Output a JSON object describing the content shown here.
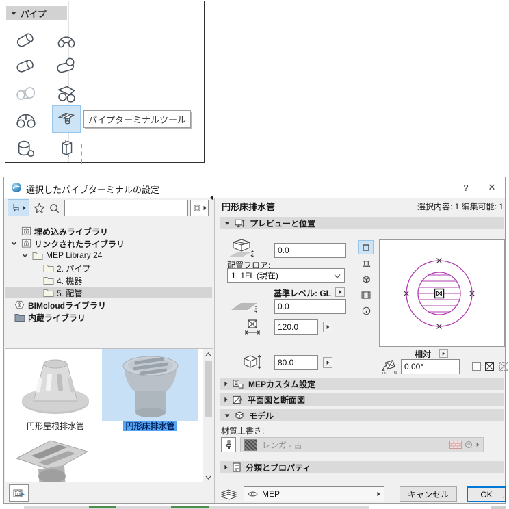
{
  "colors": {
    "selection_fill": "#cde4f7",
    "selection_border": "#96c6ec",
    "thumb_label_bg": "#54a5f6",
    "preview_magenta": "#b13cb1",
    "ok_border": "#0078d7",
    "guide_orange": "#ef8b3a"
  },
  "palette": {
    "header_label": "パイプ",
    "tooltip": "パイプターミナルツール",
    "tool_icons": [
      "pipe-straight",
      "pipe-bend",
      "pipe-straight-2",
      "pipe-tee",
      "pipe-transition",
      "pipe-wye",
      "pipe-double-bend",
      "pipe-terminal",
      "pipe-takeoff",
      "pipe-inline-object"
    ],
    "selected_tool": "pipe-terminal"
  },
  "dialog": {
    "title": "選択したパイプターミナルの設定",
    "help_label": "?",
    "close_label": "✕",
    "library_panel": {
      "search_value": "",
      "toolbar_icons": [
        "object-tool",
        "favorites-star",
        "search",
        "settings-gear"
      ],
      "tree": [
        {
          "label": "埋め込みライブラリ"
        },
        {
          "label": "リンクされたライブラリ"
        },
        {
          "label": "MEP Library 24"
        },
        {
          "label": "2. パイプ"
        },
        {
          "label": "4. 機器"
        },
        {
          "label": "5. 配管"
        },
        {
          "label": "BIMcloudライブラリ"
        },
        {
          "label": "内蔵ライブラリ"
        }
      ],
      "thumbnails": [
        {
          "label": "円形屋根排水管"
        },
        {
          "label": "円形床排水管"
        },
        {
          "label": ""
        }
      ]
    },
    "settings_panel": {
      "object_name": "円形床排水管",
      "selection_info": "選択内容: 1 編集可能: 1",
      "sections": {
        "preview_position": "プレビューと位置",
        "mep_custom": "MEPカスタム設定",
        "plan_section": "平面図と断面図",
        "model": "モデル",
        "classification": "分類とプロパティ"
      },
      "position": {
        "elevation_value": "0.0",
        "floor_label": "配置フロア:",
        "floor_value": "1. 1FL (現在)",
        "base_level_label": "基準レベル: GL",
        "offset_value": "0.0",
        "width_value": "120.0",
        "height_value": "80.0",
        "relative_label": "相対",
        "angle_value": "0.00°"
      },
      "model_section": {
        "material_label": "材質上書き:",
        "material_value": "レンガ - 古"
      },
      "footer": {
        "layer_value": "MEP",
        "cancel_label": "キャンセル",
        "ok_label": "OK"
      }
    }
  }
}
